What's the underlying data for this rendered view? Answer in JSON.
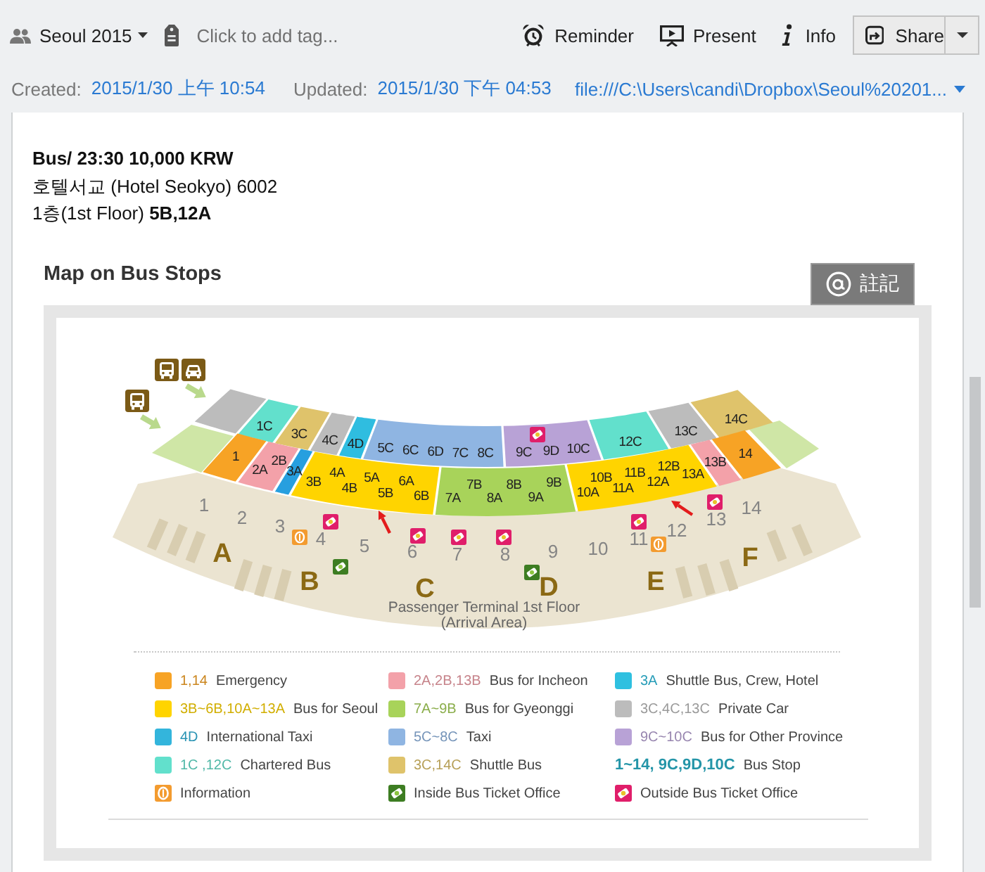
{
  "toolbar": {
    "notebook": "Seoul 2015",
    "tag_field": {
      "placeholder": "Click to add tag..."
    },
    "actions": [
      {
        "kind": "reminder",
        "label": "Reminder"
      },
      {
        "kind": "present",
        "label": "Present"
      },
      {
        "kind": "info",
        "label": "Info"
      }
    ],
    "share": {
      "label": "Share"
    }
  },
  "meta": {
    "created_label": "Created:",
    "created": "2015/1/30 上午 10:54",
    "updated_label": "Updated:",
    "updated": "2015/1/30 下午 04:53",
    "source_url": "file:///C:\\Users\\candi\\Dropbox\\Seoul%20201..."
  },
  "note": {
    "lines": [
      {
        "text": "Bus/ 23:30 10,000 KRW",
        "bold": true
      },
      {
        "text": "호텔서교 (Hotel Seokyo) 6002",
        "bold": false
      },
      {
        "text": "1층(1st Floor) **5B,12A**",
        "bold": false
      }
    ],
    "map_section": {
      "title": "Map on Bus Stops",
      "annotate_button": "註記",
      "map": {
        "upper_zones": [
          {
            "color": "#bcbcbc"
          },
          {
            "color": "#62e0cc",
            "labels": [
              "1C"
            ]
          },
          {
            "color": "#dfc36b",
            "labels": [
              "3C"
            ]
          },
          {
            "color": "#bcbcbc",
            "labels": [
              "4C"
            ]
          },
          {
            "color": "#2fbde0",
            "labels": [
              "4D"
            ]
          },
          {
            "color": "#8fb5e2",
            "labels": [
              "5C",
              "6C",
              "6D",
              "7C",
              "8C"
            ]
          },
          {
            "color": "#b8a2d6",
            "labels": [
              "9C",
              "9D",
              "10C"
            ]
          },
          {
            "color": "#62e0cc",
            "labels": [
              "12C"
            ]
          },
          {
            "color": "#bcbcbc",
            "labels": [
              "13C"
            ]
          },
          {
            "color": "#dfc36b",
            "labels": [
              "14C"
            ]
          }
        ],
        "lower_zones": [
          {
            "color": "#f7a325",
            "labels": [
              "1"
            ]
          },
          {
            "color": "#f3a1a9",
            "labels": [
              "2A",
              "2B"
            ]
          },
          {
            "color": "#279fdf",
            "labels": [
              "3A"
            ]
          },
          {
            "color": "#ffd400",
            "labels": [
              "3B",
              "4A",
              "4B",
              "5A",
              "5B",
              "6A",
              "6B"
            ]
          },
          {
            "color": "#a8d35a",
            "labels": [
              "7A",
              "7B",
              "8A",
              "8B",
              "9A",
              "9B"
            ]
          },
          {
            "color": "#ffd400",
            "labels": [
              "10A",
              "10B",
              "11A",
              "11B",
              "12A",
              "12B",
              "13A"
            ]
          },
          {
            "color": "#f3a1a9",
            "labels": [
              "13B"
            ]
          },
          {
            "color": "#f7a325",
            "labels": [
              "14"
            ]
          }
        ],
        "side_zones": [
          {
            "color": "#cfe6a6"
          },
          {
            "color": "#cfe6a6"
          }
        ],
        "stop_numbers": [
          "1",
          "2",
          "3",
          "4",
          "5",
          "6",
          "7",
          "8",
          "9",
          "10",
          "11",
          "12",
          "13",
          "14"
        ],
        "gates": [
          "A",
          "B",
          "C",
          "D",
          "E",
          "F"
        ],
        "caption": [
          "Passenger Terminal 1st Floor",
          "(Arrival Area)"
        ],
        "legend": [
          {
            "kind": "swatch",
            "color": "#f7a325",
            "code": "1,14",
            "label": "Emergency"
          },
          {
            "kind": "swatch",
            "color": "#f3a1a9",
            "code": "2A,2B,13B",
            "label": "Bus for Incheon"
          },
          {
            "kind": "swatch",
            "color": "#2fc0e0",
            "code": "3A",
            "label": "Shuttle Bus, Crew, Hotel"
          },
          {
            "kind": "swatch",
            "color": "#ffd400",
            "code": "3B~6B,10A~13A",
            "label": "Bus for Seoul"
          },
          {
            "kind": "swatch",
            "color": "#a8d35a",
            "code": "7A~9B",
            "label": "Bus for Gyeonggi"
          },
          {
            "kind": "swatch",
            "color": "#bcbcbc",
            "code": "3C,4C,13C",
            "label": "Private Car"
          },
          {
            "kind": "swatch",
            "color": "#33b5dc",
            "code": "4D",
            "label": "International Taxi"
          },
          {
            "kind": "swatch",
            "color": "#8fb5e2",
            "code": "5C~8C",
            "label": "Taxi"
          },
          {
            "kind": "swatch",
            "color": "#b8a2d6",
            "code": "9C~10C",
            "label": "Bus for Other Province"
          },
          {
            "kind": "swatch",
            "color": "#62e0cc",
            "code": "1C ,12C",
            "label": "Chartered Bus"
          },
          {
            "kind": "swatch",
            "color": "#dfc36b",
            "code": "3C,14C",
            "label": "Shuttle Bus"
          },
          {
            "kind": "stop",
            "color": "#2495a8",
            "code": "1~14, 9C,9D,10C",
            "label": "Bus Stop"
          },
          {
            "kind": "info",
            "label": "Information"
          },
          {
            "kind": "inside_ticket",
            "label": "Inside Bus Ticket Office"
          },
          {
            "kind": "outside_ticket",
            "label": "Outside Bus Ticket Office"
          }
        ]
      }
    }
  }
}
